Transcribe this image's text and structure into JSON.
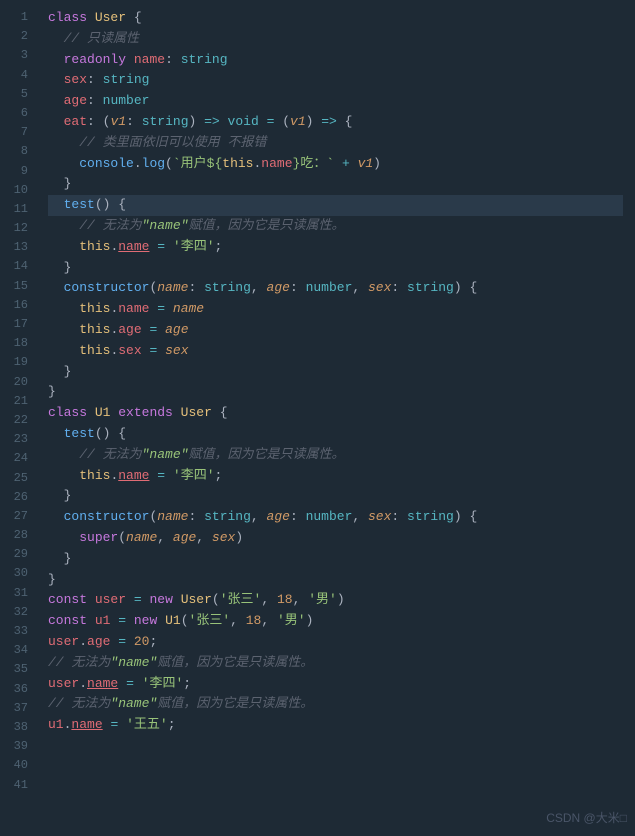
{
  "editor": {
    "background": "#1e2a35",
    "watermark": "CSDN @大米□"
  },
  "lines": [
    {
      "num": "1",
      "content": "class_User_{"
    },
    {
      "num": "2",
      "content": "  // 只读属性"
    },
    {
      "num": "3",
      "content": "  readonly_name:_string"
    },
    {
      "num": "4",
      "content": "  sex:_string"
    },
    {
      "num": "5",
      "content": "  age:_number"
    },
    {
      "num": "6",
      "content": ""
    },
    {
      "num": "7",
      "content": "  eat:_(v1:_string)_=>_void_=_(v1)_=>_{"
    },
    {
      "num": "8",
      "content": "    //_类里面依旧可以使用_不报错"
    },
    {
      "num": "9",
      "content": "    console.log(`用户${this.name}吃：`_+_v1)"
    },
    {
      "num": "10",
      "content": "  }"
    },
    {
      "num": "11",
      "content": ""
    },
    {
      "num": "12",
      "content": "  test()_{"
    },
    {
      "num": "13",
      "content": "    //_无法为\"name\"赋值，因为它是只读属性。"
    },
    {
      "num": "14",
      "content": "    this.name_=_'李四';"
    },
    {
      "num": "15",
      "content": "  }"
    },
    {
      "num": "16",
      "content": ""
    },
    {
      "num": "17",
      "content": "  constructor(name:_string,_age:_number,_sex:_string)_{"
    },
    {
      "num": "18",
      "content": "    this.name_=_name"
    },
    {
      "num": "19",
      "content": "    this.age_=_age"
    },
    {
      "num": "20",
      "content": "    this.sex_=_sex"
    },
    {
      "num": "21",
      "content": "  }"
    },
    {
      "num": "22",
      "content": "}"
    },
    {
      "num": "23",
      "content": ""
    },
    {
      "num": "24",
      "content": "class_U1_extends_User_{"
    },
    {
      "num": "25",
      "content": "  test()_{"
    },
    {
      "num": "26",
      "content": "    //_无法为\"name\"赋值，因为它是只读属性。"
    },
    {
      "num": "27",
      "content": "    this.name_=_'李四';"
    },
    {
      "num": "28",
      "content": "  }"
    },
    {
      "num": "29",
      "content": "  constructor(name:_string,_age:_number,_sex:_string)_{"
    },
    {
      "num": "30",
      "content": "    super(name,_age,_sex)"
    },
    {
      "num": "31",
      "content": "  }"
    },
    {
      "num": "32",
      "content": "}"
    },
    {
      "num": "33",
      "content": ""
    },
    {
      "num": "34",
      "content": "const_user_=_new_User('张三',_18,_'男')"
    },
    {
      "num": "35",
      "content": "const_u1_=_new_U1('张三',_18,_'男')"
    },
    {
      "num": "36",
      "content": ""
    },
    {
      "num": "37",
      "content": "user.age_=_20;"
    },
    {
      "num": "38",
      "content": "//_无法为\"name\"赋值，因为它是只读属性。"
    },
    {
      "num": "39",
      "content": "user.name_=_'李四';"
    },
    {
      "num": "40",
      "content": "//_无法为\"name\"赋值，因为它是只读属性。"
    },
    {
      "num": "41",
      "content": "u1.name_=_'王五';"
    }
  ]
}
